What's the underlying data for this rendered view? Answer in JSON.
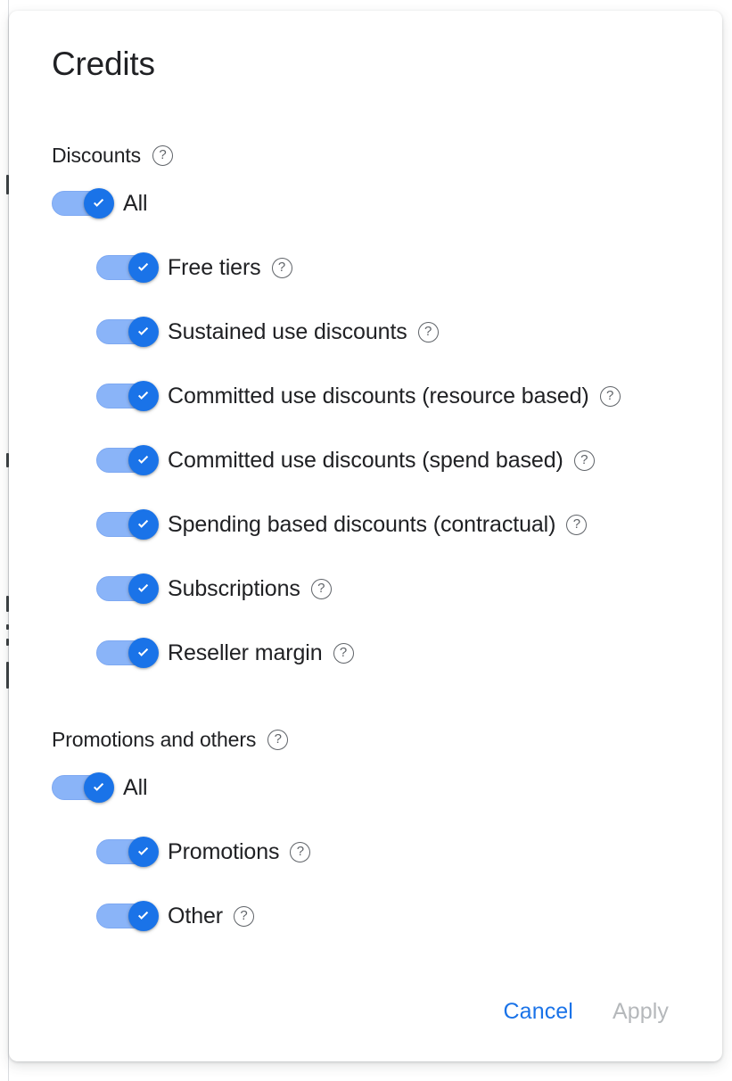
{
  "dialog": {
    "title": "Credits",
    "sections": [
      {
        "name": "discounts",
        "header": "Discounts",
        "help": "?",
        "all": {
          "label": "All",
          "checked": true
        },
        "items": [
          {
            "label": "Free tiers",
            "checked": true,
            "help": "?"
          },
          {
            "label": "Sustained use discounts",
            "checked": true,
            "help": "?"
          },
          {
            "label": "Committed use discounts (resource based)",
            "checked": true,
            "help": "?"
          },
          {
            "label": "Committed use discounts (spend based)",
            "checked": true,
            "help": "?"
          },
          {
            "label": "Spending based discounts (contractual)",
            "checked": true,
            "help": "?"
          },
          {
            "label": "Subscriptions",
            "checked": true,
            "help": "?"
          },
          {
            "label": "Reseller margin",
            "checked": true,
            "help": "?"
          }
        ]
      },
      {
        "name": "promotions-and-others",
        "header": "Promotions and others",
        "help": "?",
        "all": {
          "label": "All",
          "checked": true
        },
        "items": [
          {
            "label": "Promotions",
            "checked": true,
            "help": "?"
          },
          {
            "label": "Other",
            "checked": true,
            "help": "?"
          }
        ]
      }
    ],
    "footer": {
      "cancel_label": "Cancel",
      "apply_label": "Apply",
      "apply_disabled": true
    }
  },
  "colors": {
    "accent": "#1a73e8",
    "track": "#8ab4f8",
    "text": "#202124",
    "muted": "#5f6368",
    "disabled": "#b5b8bb"
  }
}
